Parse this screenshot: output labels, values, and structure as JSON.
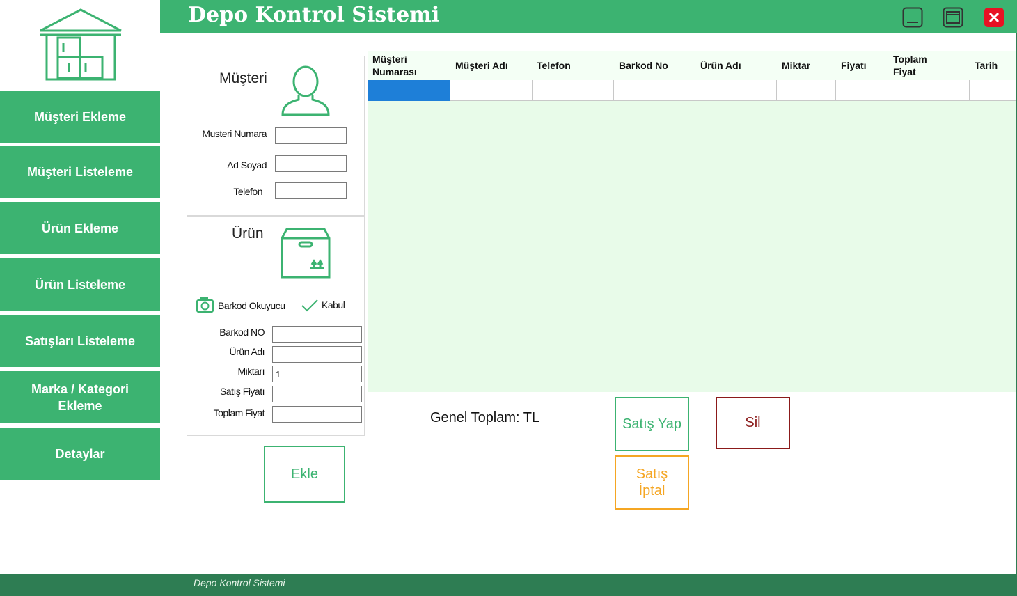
{
  "app": {
    "title": "Depo Kontrol Sistemi"
  },
  "colors": {
    "accent": "#3cb371",
    "footer": "#2e7d53",
    "grid_bg": "#e8fbe9",
    "delete": "#8b1a1a",
    "cancel": "#f5a623",
    "close": "#e81123",
    "selected_cell": "#1e7fd8"
  },
  "sidebar": {
    "logo_icon": "warehouse-icon",
    "items": [
      {
        "label": "Müşteri Ekleme"
      },
      {
        "label": "Müşteri Listeleme"
      },
      {
        "label": "Ürün Ekleme"
      },
      {
        "label": "Ürün Listeleme"
      },
      {
        "label": "Satışları Listeleme"
      },
      {
        "label": "Marka / Kategori Ekleme"
      },
      {
        "label": "Detaylar"
      }
    ]
  },
  "window_controls": {
    "minimize_icon": "minimize-icon",
    "maximize_icon": "maximize-icon",
    "close_icon": "close-icon"
  },
  "customer_panel": {
    "title": "Müşteri",
    "icon": "user-icon",
    "fields": {
      "number_label": "Musteri Numara",
      "number_value": "",
      "name_label": "Ad Soyad",
      "name_value": "",
      "phone_label": "Telefon",
      "phone_value": ""
    }
  },
  "product_panel": {
    "title": "Ürün",
    "icon": "box-icon",
    "barcode_reader_label": "Barkod Okuyucu",
    "accept_label": "Kabul",
    "fields": {
      "barcode_label": "Barkod NO",
      "barcode_value": "",
      "product_name_label": "Ürün Adı",
      "product_name_value": "",
      "quantity_label": "Miktarı",
      "quantity_value": "1",
      "price_label": "Satış Fiyatı",
      "price_value": "",
      "total_label": "Toplam Fiyat",
      "total_value": ""
    }
  },
  "buttons": {
    "add": "Ekle",
    "sell": "Satış Yap",
    "delete": "Sil",
    "cancel": "Satış İptal"
  },
  "table": {
    "columns": [
      "Müşteri Numarası",
      "Müşteri Adı",
      "Telefon",
      "Barkod No",
      "Ürün Adı",
      "Miktar",
      "Fiyatı",
      "Toplam Fiyat",
      "Tarih"
    ],
    "rows": [
      [
        "",
        "",
        "",
        "",
        "",
        "",
        "",
        "",
        ""
      ]
    ]
  },
  "summary": {
    "total_text": "Genel Toplam: TL"
  },
  "footer": {
    "text": "Depo Kontrol Sistemi"
  }
}
